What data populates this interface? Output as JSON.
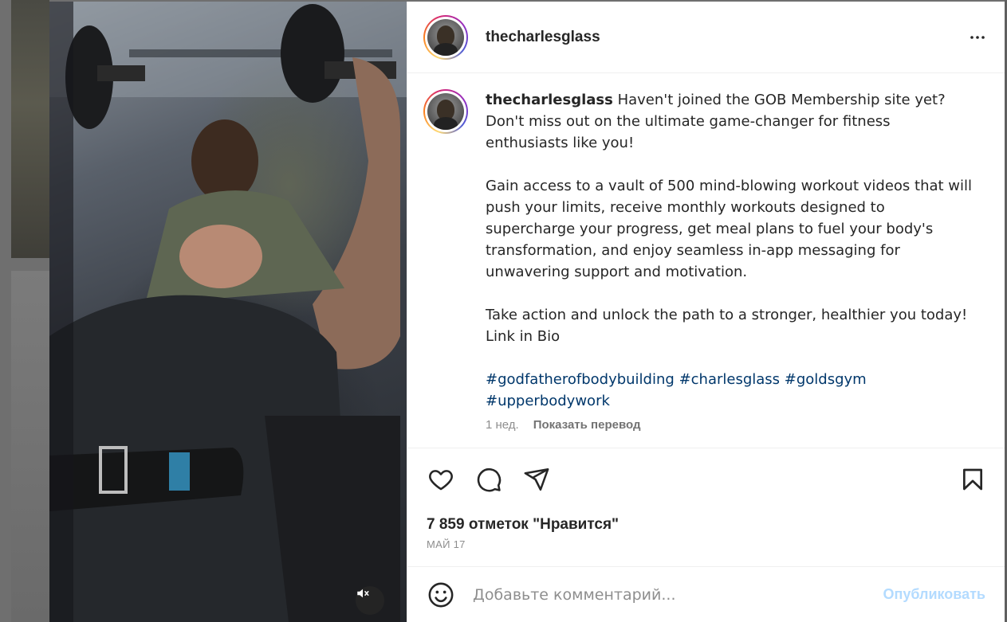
{
  "post": {
    "username": "thecharlesglass",
    "caption_paragraphs": [
      "Haven't joined the GOB Membership site yet? Don't miss out on the ultimate game-changer for fitness enthusiasts like you!",
      "Gain access to a vault of 500 mind-blowing workout videos that will push your limits, receive monthly workouts designed to supercharge your progress, get meal plans to fuel your body's transformation, and enjoy seamless in-app messaging for unwavering support and motivation.",
      "Take action and unlock the path to a stronger, healthier you today! Link in Bio"
    ],
    "hashtags": [
      "#godfatherofbodybuilding",
      "#charlesglass",
      "#goldsgym",
      "#upperbodywork"
    ],
    "age": "1 нед.",
    "translate_label": "Показать перевод",
    "likes": "7 859 отметок \"Нравится\"",
    "date": "МАЙ 17"
  },
  "comment": {
    "placeholder": "Добавьте комментарий...",
    "post_label": "Опубликовать"
  },
  "icons": {
    "more": "more-horizontal-icon",
    "like": "heart-icon",
    "comment": "comment-icon",
    "share": "send-icon",
    "save": "bookmark-icon",
    "emoji": "emoji-icon",
    "mute": "speaker-muted-icon"
  },
  "colors": {
    "hashtag": "#00376b",
    "post_button_disabled": "#b3dbff",
    "text": "#262626",
    "muted_text": "#8e8e8e"
  }
}
